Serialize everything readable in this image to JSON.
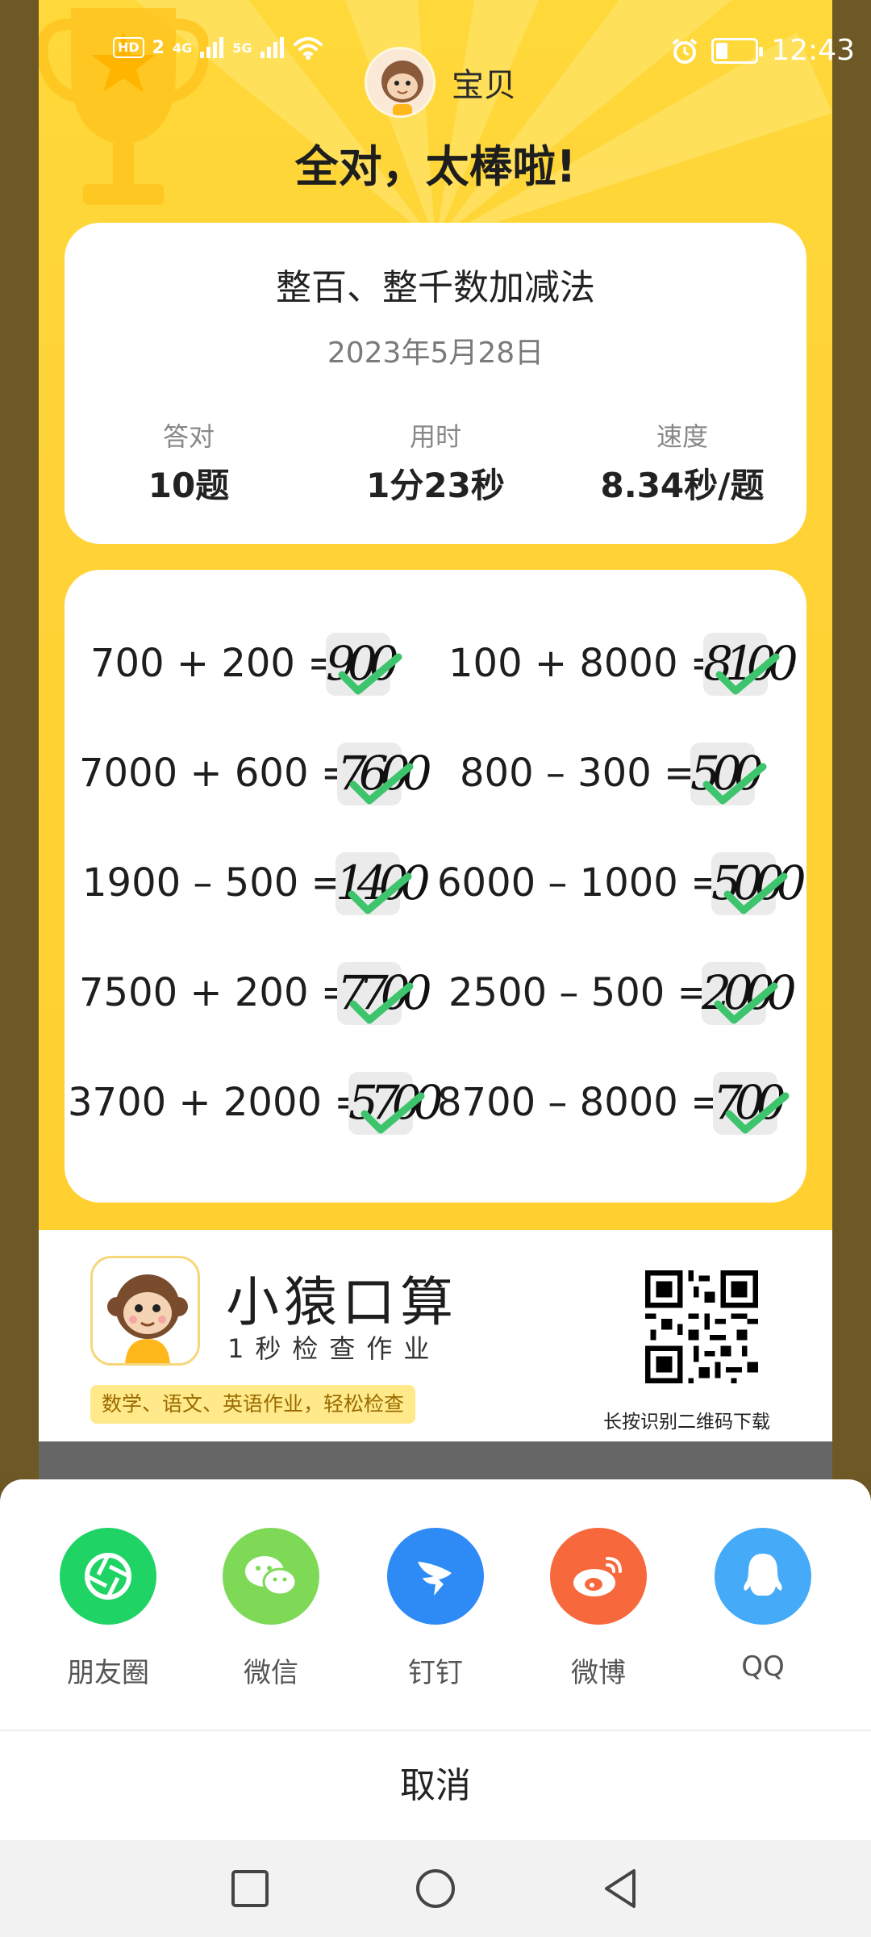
{
  "status_bar": {
    "hd": "HD",
    "sim": "2",
    "net1": "4G",
    "net2": "5G",
    "time": "12:43",
    "battery_level": 0.3
  },
  "result": {
    "username": "宝贝",
    "headline": "全对，太棒啦!",
    "topic": "整百、整千数加减法",
    "date": "2023年5月28日",
    "stats": [
      {
        "label": "答对",
        "value": "10题"
      },
      {
        "label": "用时",
        "value": "1分23秒"
      },
      {
        "label": "速度",
        "value": "8.34秒/题"
      }
    ]
  },
  "problems": [
    {
      "equation": "700 + 200 =",
      "answer": "900",
      "correct": true
    },
    {
      "equation": "100 + 8000 =",
      "answer": "8100",
      "correct": true
    },
    {
      "equation": "7000 + 600 =",
      "answer": "7600",
      "correct": true
    },
    {
      "equation": "800 – 300 =",
      "answer": "500",
      "correct": true
    },
    {
      "equation": "1900 – 500 =",
      "answer": "1400",
      "correct": true
    },
    {
      "equation": "6000 – 1000 =",
      "answer": "5000",
      "correct": true
    },
    {
      "equation": "7500 + 200 =",
      "answer": "7700",
      "correct": true
    },
    {
      "equation": "2500 – 500 =",
      "answer": "2000",
      "correct": true
    },
    {
      "equation": "3700 + 2000 =",
      "answer": "5700",
      "correct": true
    },
    {
      "equation": "8700 – 8000 =",
      "answer": "700",
      "correct": true
    }
  ],
  "promo": {
    "app_name": "小猿口算",
    "slogan": "1秒检查作业",
    "tag": "数学、语文、英语作业，轻松检查",
    "qr_caption": "长按识别二维码下载"
  },
  "share": {
    "targets": [
      {
        "label": "朋友圈",
        "icon": "moments-icon",
        "color": "#1fd464"
      },
      {
        "label": "微信",
        "icon": "wechat-icon",
        "color": "#7ed957"
      },
      {
        "label": "钉钉",
        "icon": "dingtalk-icon",
        "color": "#2e8bf5"
      },
      {
        "label": "微博",
        "icon": "weibo-icon",
        "color": "#f7683d"
      },
      {
        "label": "QQ",
        "icon": "qq-icon",
        "color": "#45aaf7"
      }
    ],
    "cancel": "取消"
  },
  "colors": {
    "poster_yellow": "#ffd235",
    "tick_green": "#3ec46d",
    "overlay_dim": "#6e5825"
  }
}
